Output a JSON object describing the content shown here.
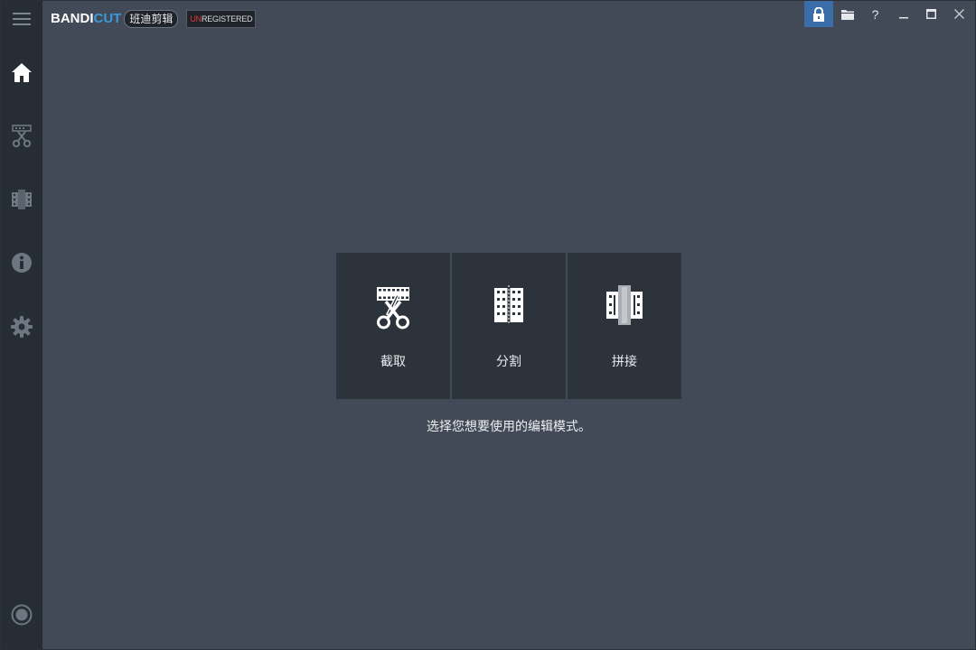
{
  "app": {
    "logo_bandi": "BANDI",
    "logo_cut": "CUT",
    "cn_name": "班迪剪辑",
    "unreg_prefix": "UN",
    "unreg_rest": "REGISTERED"
  },
  "sidebar": {
    "items": [
      {
        "icon": "menu-icon"
      },
      {
        "icon": "home-icon"
      },
      {
        "icon": "cut-icon"
      },
      {
        "icon": "join-icon"
      },
      {
        "icon": "info-icon"
      },
      {
        "icon": "gear-icon"
      },
      {
        "icon": "record-icon"
      }
    ]
  },
  "window_controls": {
    "help": "?",
    "icons": [
      "lock-icon",
      "folder-icon",
      "help-icon",
      "minimize-icon",
      "maximize-icon",
      "close-icon"
    ]
  },
  "modes": [
    {
      "label": "截取",
      "icon": "trim-icon"
    },
    {
      "label": "分割",
      "icon": "split-icon"
    },
    {
      "label": "拼接",
      "icon": "join-icon"
    }
  ],
  "hint": "选择您想要使用的编辑模式。",
  "colors": {
    "background": "#414a56",
    "sidebar": "#272d35",
    "card": "#2d333b",
    "accent": "#3a9ad9",
    "lock_active": "#3b6ea8",
    "unregistered_red": "#e0383a"
  }
}
